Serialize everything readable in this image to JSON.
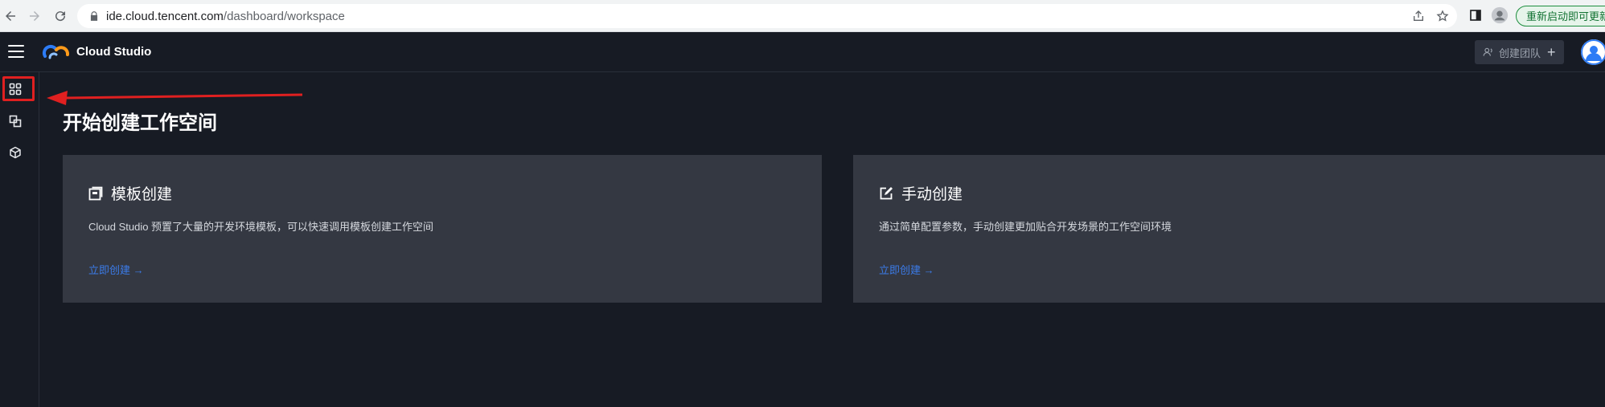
{
  "browser": {
    "url_host": "ide.cloud.tencent.com",
    "url_path": "/dashboard/workspace",
    "restart_label": "重新启动即可更新"
  },
  "header": {
    "brand": "Cloud Studio",
    "team_button_label": "创建团队"
  },
  "sidebar": {
    "items": [
      {
        "icon": "grid-icon",
        "active": true
      },
      {
        "icon": "copy-icon"
      },
      {
        "icon": "cube-icon"
      }
    ]
  },
  "main": {
    "page_title": "开始创建工作空间",
    "cards": [
      {
        "icon": "template-icon",
        "title": "模板创建",
        "description": "Cloud Studio 预置了大量的开发环境模板，可以快速调用模板创建工作空间",
        "link": "立即创建 →"
      },
      {
        "icon": "edit-icon",
        "title": "手动创建",
        "description": "通过简单配置参数，手动创建更加贴合开发场景的工作空间环境",
        "link": "立即创建 →"
      }
    ]
  },
  "colors": {
    "background": "#171b24",
    "card": "#343842",
    "link": "#3b7be8",
    "annotation": "#e02020"
  }
}
